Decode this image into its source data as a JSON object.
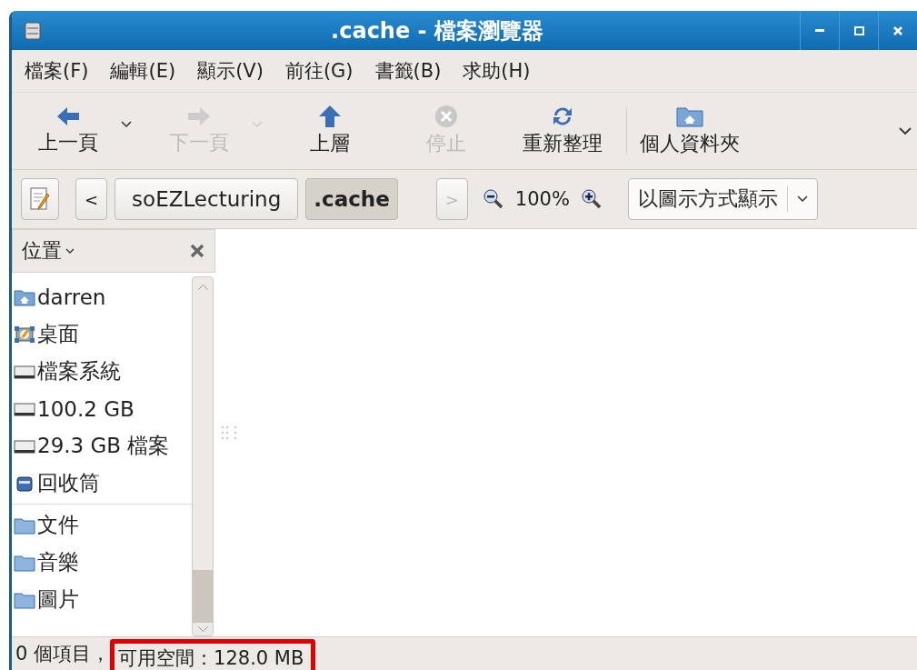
{
  "window": {
    "title": ".cache - 檔案瀏覽器"
  },
  "menu": [
    "檔案(F)",
    "編輯(E)",
    "顯示(V)",
    "前往(G)",
    "書籤(B)",
    "求助(H)"
  ],
  "toolbar": [
    {
      "kind": "back",
      "label": "上一頁",
      "disabled": false,
      "dropdown": true
    },
    {
      "kind": "forward",
      "label": "下一頁",
      "disabled": true,
      "dropdown": true
    },
    {
      "kind": "up",
      "label": "上層",
      "disabled": false,
      "dropdown": false
    },
    {
      "kind": "stop",
      "label": "停止",
      "disabled": true,
      "dropdown": false
    },
    {
      "kind": "reload",
      "label": "重新整理",
      "disabled": false,
      "dropdown": false
    },
    {
      "kind": "home",
      "label": "個人資料夾",
      "disabled": false,
      "dropdown": false
    }
  ],
  "location": {
    "back": "<",
    "crumbs": [
      {
        "label": "soEZLecturing",
        "selected": false
      },
      {
        "label": ".cache",
        "selected": true
      }
    ],
    "forward": ">",
    "zoom": "100%",
    "view": "以圖示方式顯示"
  },
  "sidebar": {
    "title": "位置",
    "sections": [
      [
        {
          "kind": "home",
          "label": "darren"
        },
        {
          "kind": "desktop",
          "label": "桌面"
        },
        {
          "kind": "drive",
          "label": "檔案系統"
        },
        {
          "kind": "drive",
          "label": "100.2 GB"
        },
        {
          "kind": "drive",
          "label": "29.3 GB 檔案"
        },
        {
          "kind": "trash",
          "label": "回收筒"
        }
      ],
      [
        {
          "kind": "folder",
          "label": "文件"
        },
        {
          "kind": "folder",
          "label": "音樂"
        },
        {
          "kind": "folder",
          "label": "圖片"
        }
      ]
    ]
  },
  "status_bar": {
    "items": "0 個項目，",
    "free_space": "可用空間：128.0 MB",
    "highlighted": true
  }
}
